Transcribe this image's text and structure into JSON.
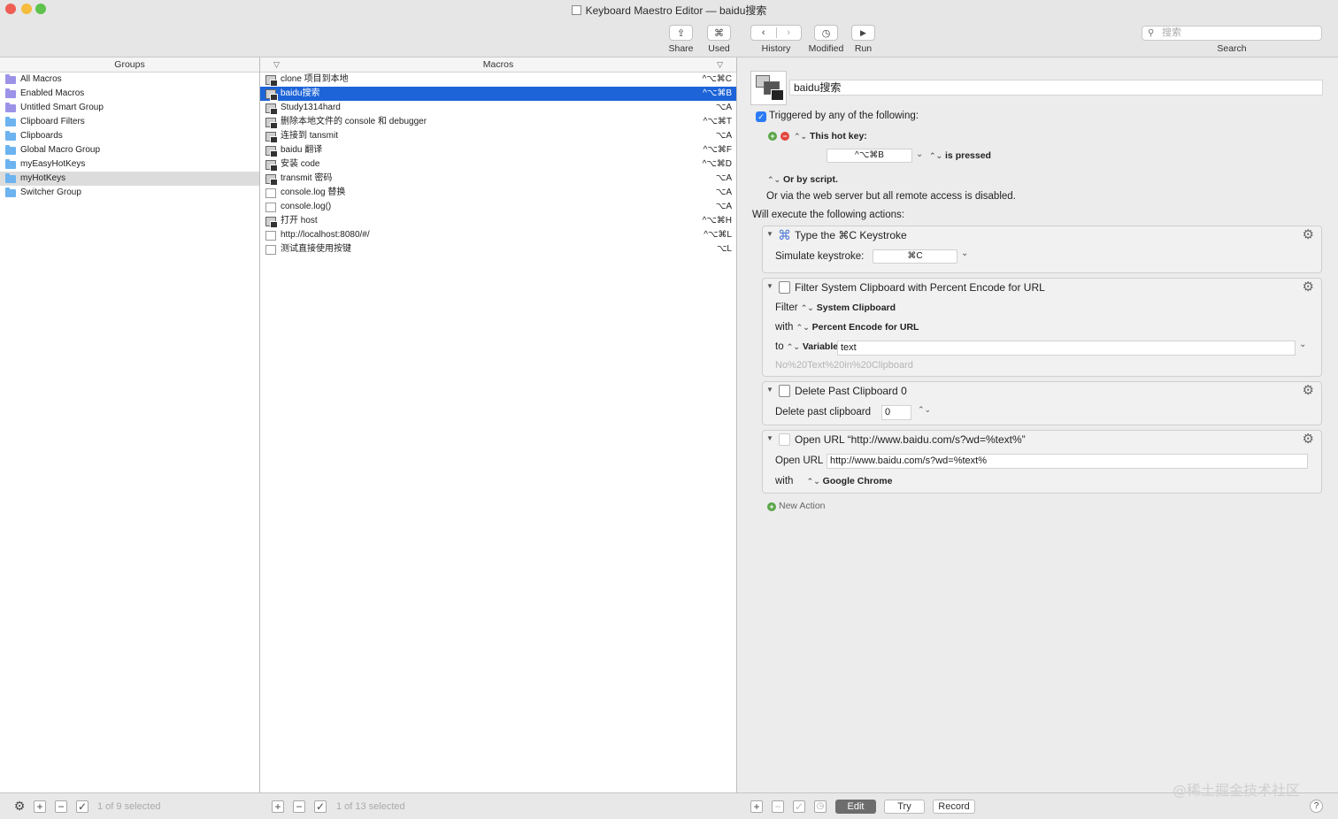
{
  "window": {
    "title": "Keyboard Maestro Editor — baidu搜索"
  },
  "toolbar": {
    "share": "Share",
    "used": "Used",
    "history": "History",
    "modified": "Modified",
    "run": "Run",
    "search_label": "Search",
    "search_placeholder": "搜索"
  },
  "groups": {
    "header": "Groups",
    "items": [
      {
        "label": "All Macros",
        "smart": true
      },
      {
        "label": "Enabled Macros",
        "smart": true
      },
      {
        "label": "Untitled Smart Group",
        "smart": true
      },
      {
        "label": "Clipboard Filters",
        "smart": false
      },
      {
        "label": "Clipboards",
        "smart": false
      },
      {
        "label": "Global Macro Group",
        "smart": false
      },
      {
        "label": "myEasyHotKeys",
        "smart": false
      },
      {
        "label": "myHotKeys",
        "smart": false,
        "selected": true
      },
      {
        "label": "Switcher Group",
        "smart": false
      }
    ],
    "status": "1 of 9 selected"
  },
  "macros": {
    "header": "Macros",
    "items": [
      {
        "name": "clone 项目到本地",
        "hotkey": "^⌥⌘C"
      },
      {
        "name": "baidu搜索",
        "hotkey": "^⌥⌘B",
        "selected": true
      },
      {
        "name": "Study1314hard",
        "hotkey": "⌥A"
      },
      {
        "name": "删除本地文件的 console 和 debugger",
        "hotkey": "^⌥⌘T"
      },
      {
        "name": "连接到 tansmit",
        "hotkey": "⌥A"
      },
      {
        "name": "baidu 翻译",
        "hotkey": "^⌥⌘F"
      },
      {
        "name": "安装 code",
        "hotkey": "^⌥⌘D"
      },
      {
        "name": "transmit 密码",
        "hotkey": "⌥A"
      },
      {
        "name": "console.log 替换",
        "hotkey": "⌥A",
        "plain": true
      },
      {
        "name": "console.log()",
        "hotkey": "⌥A",
        "plain": true
      },
      {
        "name": "打开 host",
        "hotkey": "^⌥⌘H"
      },
      {
        "name": "http://localhost:8080/#/",
        "hotkey": "^⌥⌘L",
        "plain": true
      },
      {
        "name": "测试直接使用按键",
        "hotkey": "⌥L",
        "plain": true
      }
    ],
    "status": "1 of 13 selected"
  },
  "editor": {
    "macro_name": "baidu搜索",
    "trigger_text": "Triggered by any of the following:",
    "hotkey_label": "This hot key:",
    "hotkey_value": "^⌥⌘B",
    "is_pressed": "is pressed",
    "or_by_script": "Or by script.",
    "web_server_text": "Or via the web server but all remote access is disabled.",
    "will_execute": "Will execute the following actions:",
    "new_action": "New Action",
    "actions": {
      "a1": {
        "title": "Type the ⌘C Keystroke",
        "simulate_label": "Simulate keystroke:",
        "keystroke": "⌘C"
      },
      "a2": {
        "title": "Filter System Clipboard with Percent Encode for URL",
        "filter_label": "Filter",
        "filter_value": "System Clipboard",
        "with_label": "with",
        "with_value": "Percent Encode for URL",
        "to_label": "to",
        "to_value": "Variable",
        "variable_name": "text",
        "preview": "No%20Text%20in%20Clipboard"
      },
      "a3": {
        "title": "Delete Past Clipboard 0",
        "label": "Delete past clipboard",
        "value": "0"
      },
      "a4": {
        "title": "Open URL “http://www.baidu.com/s?wd=%text%”",
        "url_label": "Open URL",
        "url_value": "http://www.baidu.com/s?wd=%text%",
        "with_label": "with",
        "with_value": "Google Chrome"
      }
    }
  },
  "bottom": {
    "edit": "Edit",
    "try": "Try",
    "record": "Record"
  },
  "watermark": "@稀土掘金技术社区",
  "colors": {
    "selection_blue": "#1d64d8",
    "smart_folder": "#9c93e8",
    "folder": "#6cb3ef",
    "checkbox": "#2c7bf6"
  }
}
